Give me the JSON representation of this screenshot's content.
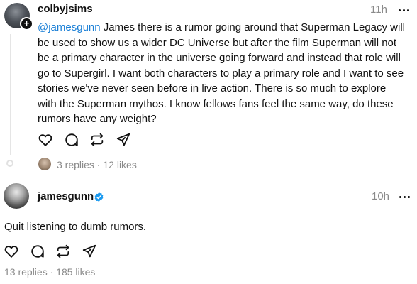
{
  "post": {
    "username": "colbyjsims",
    "time": "11h",
    "mention": "@jamesgunn",
    "text": " James there is a rumor going around that Superman Legacy will be used to show us a wider DC Universe but after the film Superman will not be a primary character in the universe going forward and instead that role will go to Supergirl. I want both characters to play a primary role and I want to see stories we've never seen before in live action. There is so much to explore with the Superman mythos. I know fellows fans feel the same way, do these rumors have any weight?",
    "replies": "3 replies",
    "separator": " · ",
    "likes": "12 likes",
    "follow_icon": "plus-icon"
  },
  "reply": {
    "username": "jamesgunn",
    "time": "10h",
    "text": "Quit listening to dumb rumors.",
    "replies": "13 replies",
    "separator": " · ",
    "likes": "185 likes",
    "verified_icon": "verified-badge-icon",
    "verified_color": "#1d9bf0"
  },
  "icons": {
    "like": "heart-icon",
    "comment": "comment-icon",
    "repost": "repost-icon",
    "share": "send-icon",
    "more": "more-icon"
  },
  "colors": {
    "mention": "#1a7fd6",
    "secondary_text": "#8a8a8a"
  }
}
